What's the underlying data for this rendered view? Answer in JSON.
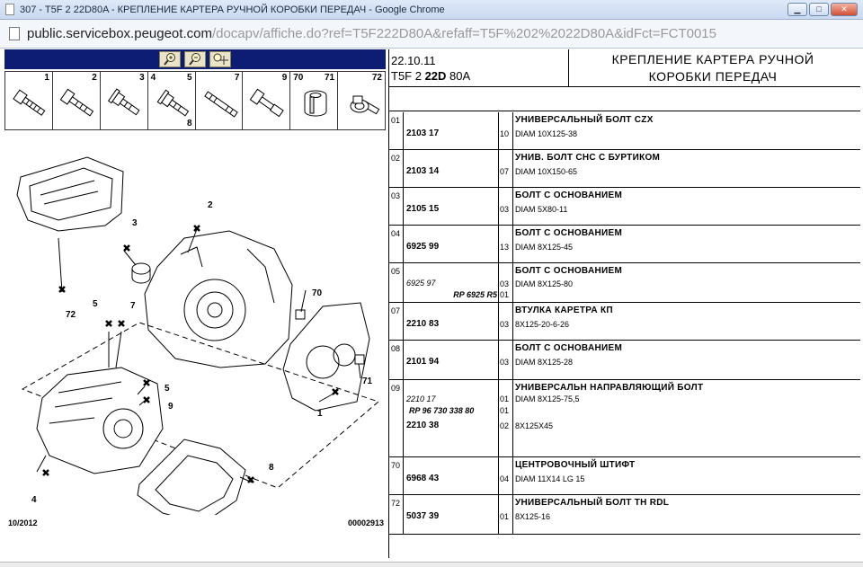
{
  "window": {
    "title": "307 - T5F 2 22D80A - КРЕПЛЕНИЕ КАРТЕРА РУЧНОЙ КОРОБКИ ПЕРЕДАЧ - Google Chrome",
    "buttons": {
      "minimize": "▁",
      "maximize": "□",
      "close": "✕"
    }
  },
  "address": {
    "host": "public.servicebox.peugeot.com",
    "path": "/docapv/affiche.do?ref=T5F222D80A&refaff=T5F%202%2022D80A&idFct=FCT0015"
  },
  "toolbar": {
    "zoom_in_icon": "magnifier-plus",
    "zoom_out_icon": "magnifier-minus",
    "pan_icon": "move-cross"
  },
  "parts_strip": [
    {
      "num": "1"
    },
    {
      "num": "2"
    },
    {
      "num": "3"
    },
    {
      "num": "4",
      "num2": "5",
      "num3": "8"
    },
    {
      "num": "7"
    },
    {
      "num": "9"
    },
    {
      "num": "70",
      "num2": "71"
    },
    {
      "num": "72"
    }
  ],
  "diagram_labels": [
    "1",
    "2",
    "3",
    "4",
    "5",
    "5",
    "7",
    "8",
    "8",
    "9",
    "70",
    "71",
    "72"
  ],
  "left_footer": {
    "date": "10/2012",
    "code": "00002913"
  },
  "header": {
    "date": "22.10.11",
    "ref_prefix": "T5F 2 ",
    "ref_bold": "22D",
    "ref_suffix": " 80A",
    "title_line1": "КРЕПЛЕНИЕ КАРТЕРА РУЧНОЙ",
    "title_line2": "КОРОБКИ ПЕРЕДАЧ"
  },
  "rows": [
    {
      "pos": "01",
      "ref": "2103 17",
      "qty": "10",
      "desc": "УНИВЕРСАЛЬНЫЙ БОЛТ CZX",
      "spec": "DIAM 10X125-38"
    },
    {
      "pos": "02",
      "ref": "2103 14",
      "qty": "07",
      "desc": "УНИВ. БОЛТ CHC С БУРТИКОМ",
      "spec": "DIAM 10X150-65"
    },
    {
      "pos": "03",
      "ref": "2105 15",
      "qty": "03",
      "desc": "БОЛТ С ОСНОВАНИЕМ",
      "spec": "DIAM 5X80-11"
    },
    {
      "pos": "04",
      "ref": "6925 99",
      "qty": "13",
      "desc": "БОЛТ С ОСНОВАНИЕМ",
      "spec": "DIAM 8X125-45"
    },
    {
      "pos": "05",
      "ref_alt": "6925 97",
      "qty": "03",
      "rp": "RP 6925 R5",
      "qty2": "01",
      "desc": "БОЛТ С ОСНОВАНИЕМ",
      "spec": "DIAM 8X125-80"
    },
    {
      "pos": "07",
      "ref": "2210 83",
      "qty": "03",
      "desc": "ВТУЛКА КАРЕТРА КП",
      "spec": "8X125-20-6-26"
    },
    {
      "pos": "08",
      "ref": "2101 94",
      "qty": "03",
      "desc": "БОЛТ С ОСНОВАНИЕМ",
      "spec": "DIAM 8X125-28"
    },
    {
      "pos": "09",
      "ref_alt": "2210 17",
      "qty": "01",
      "rp": "RP 96 730 338 80",
      "qty2": "01",
      "ref3": "2210 38",
      "qty3": "02",
      "desc": "УНИВЕРСАЛЬН НАПРАВЛЯЮЩИЙ БОЛТ",
      "spec": "DIAM 8X125-75,5",
      "spec3": "8X125X45"
    },
    {
      "pos": "70",
      "ref": "6968 43",
      "qty": "04",
      "desc": "ЦЕНТРОВОЧНЫЙ ШТИФТ",
      "spec": "DIAM 11X14 LG 15"
    },
    {
      "pos": "72",
      "ref": "5037 39",
      "qty": "01",
      "desc": "УНИВЕРСАЛЬНЫЙ БОЛТ TH RDL",
      "spec": "8X125-16"
    }
  ]
}
